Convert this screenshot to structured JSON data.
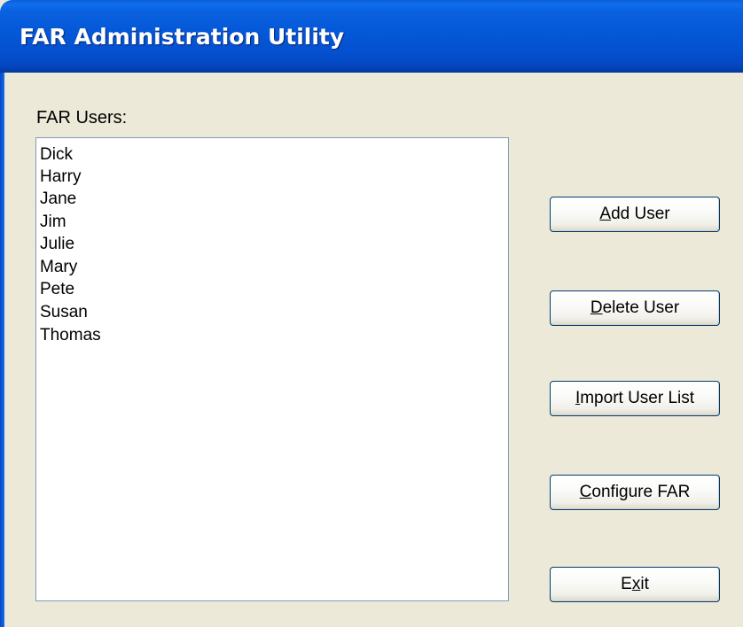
{
  "window": {
    "title": "FAR Administration Utility"
  },
  "users_label": "FAR Users:",
  "users": [
    "Dick",
    "Harry",
    "Jane",
    "Jim",
    "Julie",
    "Mary",
    "Pete",
    "Susan",
    "Thomas"
  ],
  "buttons": {
    "add_user": {
      "accel": "A",
      "rest": "dd User"
    },
    "delete_user": {
      "accel": "D",
      "rest": "elete User"
    },
    "import_user_list": {
      "accel": "I",
      "rest": "mport User List"
    },
    "configure_far": {
      "accel": "C",
      "rest": "onfigure FAR"
    },
    "exit": {
      "pre": "E",
      "accel": "x",
      "rest": "it"
    }
  },
  "colors": {
    "titlebar": "#0559d8",
    "window_bg": "#ece9d8",
    "button_border": "#003c74",
    "list_border": "#7f9db9"
  }
}
